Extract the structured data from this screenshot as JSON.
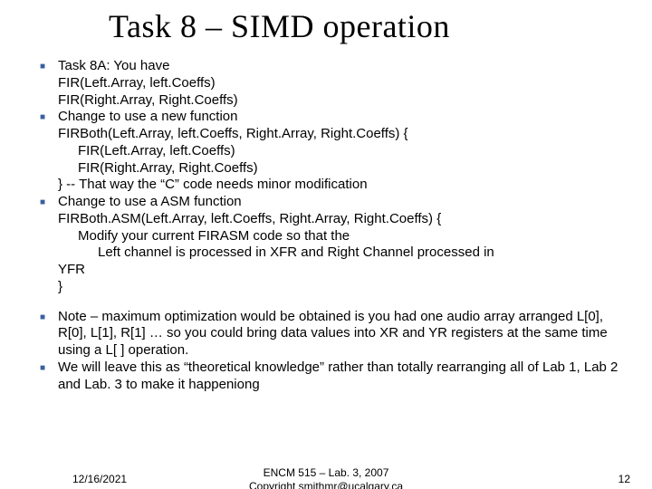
{
  "title": "Task 8 – SIMD operation",
  "b1": {
    "l1": "Task 8A: You have",
    "l2": "FIR(Left.Array, left.Coeffs)",
    "l3": "FIR(Right.Array, Right.Coeffs)"
  },
  "b2": {
    "l1": "Change to use a new function",
    "l2": "FIRBoth(Left.Array, left.Coeffs, Right.Array, Right.Coeffs) {",
    "l3": "FIR(Left.Array, left.Coeffs)",
    "l4": "FIR(Right.Array, Right.Coeffs)",
    "l5": "}  -- That way the “C” code needs minor modification"
  },
  "b3": {
    "l1": "Change to use a ASM function",
    "l2": "FIRBoth.ASM(Left.Array, left.Coeffs, Right.Array, Right.Coeffs) {",
    "l3": "Modify your current FIRASM code so that the",
    "l4": "Left channel is processed in XFR and Right Channel processed in",
    "l5": "YFR",
    "l6": "}"
  },
  "b4": "Note – maximum optimization would be obtained is you had one audio array arranged L[0], R[0], L[1], R[1] … so you could bring data values into XR and YR registers at the same time using a L[ ] operation.",
  "b5": "We will leave this as “theoretical knowledge” rather than totally rearranging all of Lab 1, Lab 2 and Lab. 3 to make it happeniong",
  "footer": {
    "date": "12/16/2021",
    "center1": "ENCM 515 – Lab. 3, 2007",
    "center2": "Copyright smithmr@ucalgary.ca",
    "pagenum": "12"
  }
}
